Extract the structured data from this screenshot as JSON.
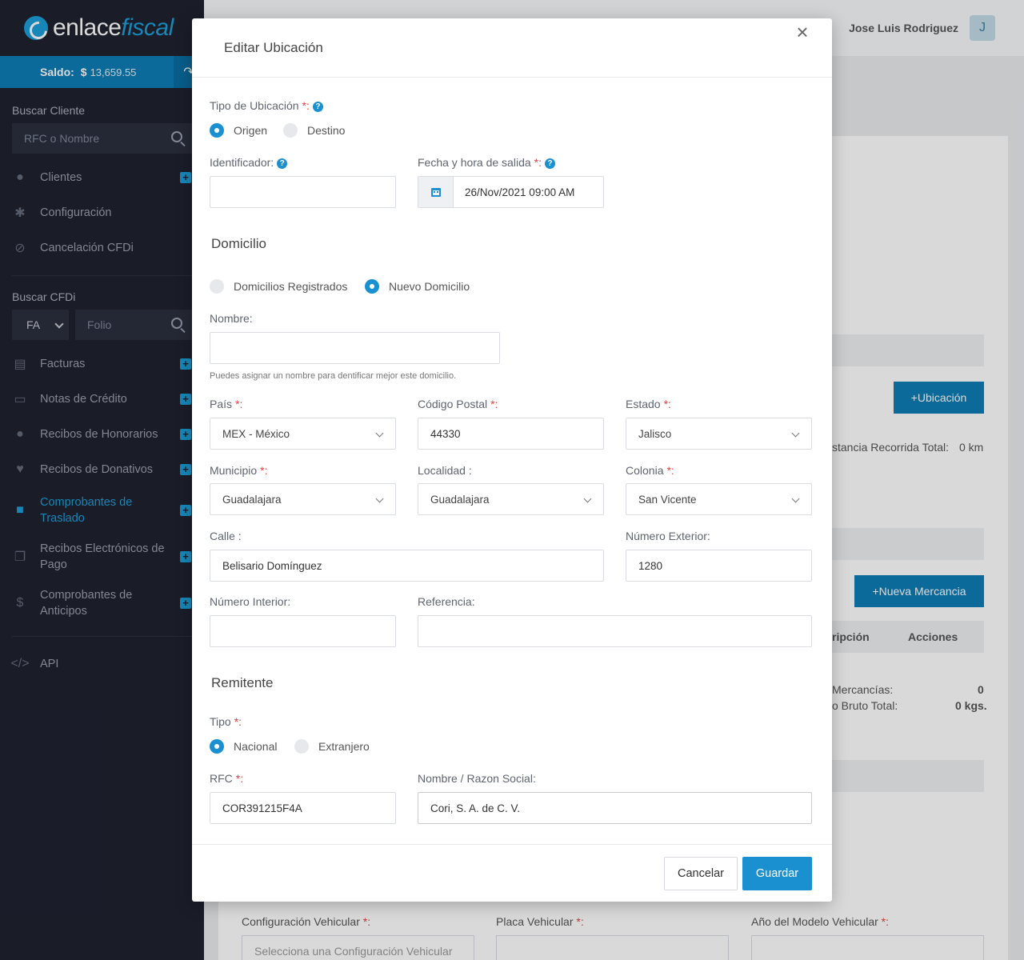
{
  "sidebar": {
    "logo": {
      "part1": "enlace",
      "part2": "fiscal"
    },
    "saldo_label": "Saldo:",
    "saldo_currency": "$",
    "saldo_amount": "13,659.55",
    "buscar_cliente_title": "Buscar Cliente",
    "buscar_cliente_placeholder": "RFC o Nombre",
    "menu1": [
      {
        "label": "Clientes",
        "icon": "user-icon"
      },
      {
        "label": "Configuración",
        "icon": "gear-icon"
      },
      {
        "label": "Cancelación CFDi",
        "icon": "ban-icon"
      }
    ],
    "buscar_cfdi_title": "Buscar CFDi",
    "cfdi_type": "FA",
    "folio_placeholder": "Folio",
    "menu2": [
      {
        "label": "Facturas",
        "icon": "file-icon"
      },
      {
        "label": "Notas de Crédito",
        "icon": "credit-card-icon"
      },
      {
        "label": "Recibos de Honorarios",
        "icon": "users-icon"
      },
      {
        "label": "Recibos de Donativos",
        "icon": "donation-icon"
      },
      {
        "label": "Comprobantes de Traslado",
        "icon": "truck-icon"
      },
      {
        "label": "Recibos Electrónicos de Pago",
        "icon": "copy-icon"
      },
      {
        "label": "Comprobantes de Anticipos",
        "icon": "dollar-icon"
      }
    ],
    "api_label": "API"
  },
  "topbar": {
    "user_name": "Jose Luis Rodriguez",
    "avatar_initial": "J"
  },
  "background": {
    "ubicacion_button": "Ubicación",
    "distancia_label": "stancia Recorrida Total:",
    "distancia_value": "0 km",
    "nueva_mercancia_button": "Nueva Mercancia",
    "col_descripcion": "ripción",
    "col_acciones": "Acciones",
    "mercancias_label": "Mercancías:",
    "mercancias_value": "0",
    "peso_label": "o Bruto Total:",
    "peso_value": "0 kgs.",
    "config_vehicular_label": "Configuración Vehicular",
    "config_vehicular_placeholder": "Selecciona una Configuración Vehicular",
    "placa_label": "Placa Vehicular",
    "anio_label": "Año del Modelo Vehicular"
  },
  "modal": {
    "title": "Editar Ubicación",
    "close": "×",
    "tipo_ubicacion_label": "Tipo de Ubicación",
    "tipo_origen": "Origen",
    "tipo_destino": "Destino",
    "identificador_label": "Identificador:",
    "identificador_value": "",
    "fecha_label": "Fecha y hora de salida",
    "fecha_value": "26/Nov/2021 09:00 AM",
    "domicilio_title": "Domicilio",
    "dom_registrados": "Domicilios Registrados",
    "dom_nuevo": "Nuevo Domicilio",
    "nombre_label": "Nombre:",
    "nombre_value": "",
    "nombre_hint": "Puedes asignar un nombre para dentificar mejor este domicilio.",
    "pais_label": "País",
    "pais_value": "MEX - México",
    "cp_label": "Código Postal",
    "cp_value": "44330",
    "estado_label": "Estado",
    "estado_value": "Jalisco",
    "municipio_label": "Municipio",
    "municipio_value": "Guadalajara",
    "localidad_label": "Localidad :",
    "localidad_value": "Guadalajara",
    "colonia_label": "Colonia",
    "colonia_value": "San Vicente",
    "calle_label": "Calle :",
    "calle_value": "Belisario Domínguez",
    "num_ext_label": "Número Exterior:",
    "num_ext_value": "1280",
    "num_int_label": "Número Interior:",
    "num_int_value": "",
    "referencia_label": "Referencia:",
    "referencia_value": "",
    "remitente_title": "Remitente",
    "tipo_label": "Tipo",
    "tipo_nacional": "Nacional",
    "tipo_extranjero": "Extranjero",
    "rfc_label": "RFC",
    "rfc_value": "COR391215F4A",
    "razon_label": "Nombre / Razon Social:",
    "razon_value": "Cori, S. A. de C. V.",
    "req_mark": "*:",
    "colon": ":",
    "help_mark": "?",
    "cancel_button": "Cancelar",
    "save_button": "Guardar"
  },
  "colors": {
    "accent": "#1a90d0",
    "sidebar_bg": "#1f2230",
    "required": "#e04141"
  }
}
